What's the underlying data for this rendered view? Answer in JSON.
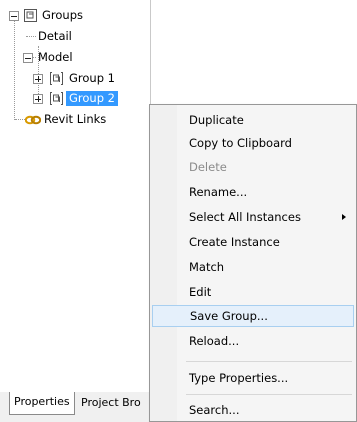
{
  "tree": {
    "groups_label": "Groups",
    "detail_label": "Detail",
    "model_label": "Model",
    "group1_label": "Group 1",
    "group2_label": "Group 2",
    "revit_links_label": "Revit Links"
  },
  "tabs": {
    "properties_label": "Properties",
    "project_browser_label": "Project Bro"
  },
  "context_menu": {
    "items": [
      {
        "label": "Duplicate",
        "enabled": true
      },
      {
        "label": "Copy to Clipboard",
        "enabled": true
      },
      {
        "label": "Delete",
        "enabled": false
      },
      {
        "label": "Rename...",
        "enabled": true
      },
      {
        "label": "Select All Instances",
        "enabled": true,
        "submenu": true
      },
      {
        "label": "Create Instance",
        "enabled": true
      },
      {
        "label": "Match",
        "enabled": true
      },
      {
        "label": "Edit",
        "enabled": true
      },
      {
        "label": "Save Group...",
        "enabled": true,
        "highlighted": true
      },
      {
        "label": "Reload...",
        "enabled": true
      },
      {
        "label": "Type Properties...",
        "enabled": true
      },
      {
        "label": "Search...",
        "enabled": true
      }
    ]
  },
  "colors": {
    "selection": "#3399ff",
    "menu_highlight": "#e5f0fb",
    "menu_highlight_border": "#a8cff0",
    "link_icon": "#e0a000"
  },
  "icons": {
    "expander_minus": "minus-expander-icon",
    "expander_plus": "plus-expander-icon",
    "group": "group-icon",
    "revit_link": "revit-link-icon",
    "submenu": "submenu-arrow-icon"
  }
}
